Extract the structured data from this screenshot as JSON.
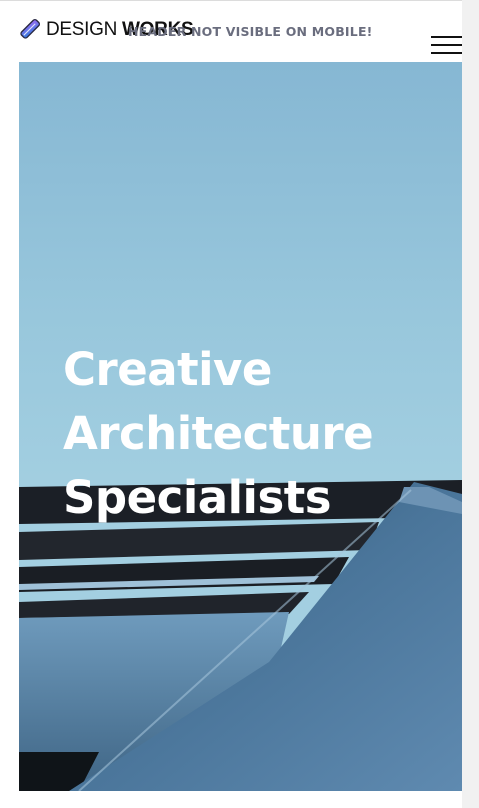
{
  "header": {
    "logo": {
      "light_text": "DESIGN",
      "bold_text": "WORKS",
      "icon": "pen-logo-icon",
      "colors": [
        "#9b6cf0",
        "#2d7be0",
        "#3a3a5a"
      ]
    },
    "mobile_note": "HEADER NOT VISIBLE ON MOBILE!",
    "menu_icon": "hamburger-menu-icon"
  },
  "hero": {
    "title_lines": [
      "Creative",
      "Architecture",
      "Specialists"
    ],
    "sky_color": "#8fbfd6",
    "building_color": "#3d6585"
  }
}
